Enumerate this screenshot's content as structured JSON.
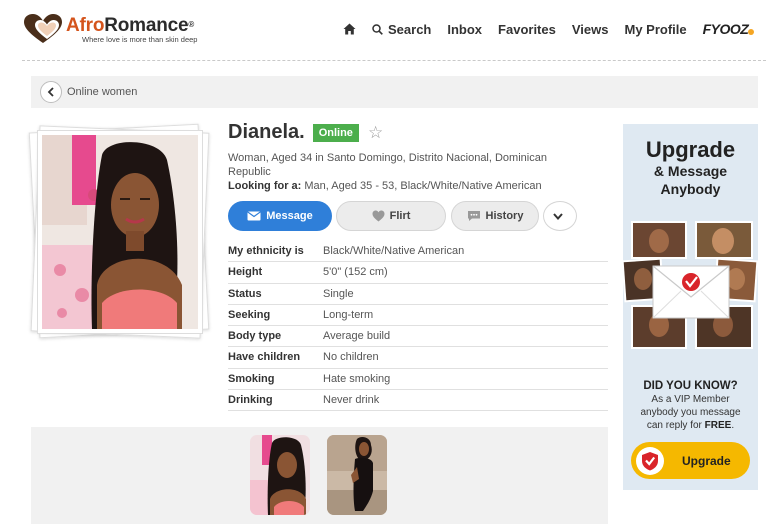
{
  "header": {
    "logo_part1": "Afro",
    "logo_part2": "Romance",
    "logo_reg": "®",
    "tagline": "Where love is more than skin deep",
    "nav": {
      "search": "Search",
      "inbox": "Inbox",
      "favorites": "Favorites",
      "views": "Views",
      "my_profile": "My Profile",
      "fyooz": "FYOOZ"
    }
  },
  "breadcrumb": {
    "label": "Online women"
  },
  "profile": {
    "name": "Dianela.",
    "status_badge": "Online",
    "description": "Woman, Aged 34 in Santo Domingo, Distrito Nacional, Dominican Republic",
    "looking_for_label": "Looking for a:",
    "looking_for_value": "Man, Aged 35 - 53, Black/White/Native American",
    "actions": {
      "message": "Message",
      "flirt": "Flirt",
      "history": "History"
    },
    "details": [
      {
        "label": "My ethnicity is",
        "value": "Black/White/Native American"
      },
      {
        "label": "Height",
        "value": "5'0\" (152 cm)"
      },
      {
        "label": "Status",
        "value": "Single"
      },
      {
        "label": "Seeking",
        "value": "Long-term"
      },
      {
        "label": "Body type",
        "value": "Average build"
      },
      {
        "label": "Have children",
        "value": "No children"
      },
      {
        "label": "Smoking",
        "value": "Hate smoking"
      },
      {
        "label": "Drinking",
        "value": "Never drink"
      }
    ]
  },
  "upgrade": {
    "title": "Upgrade",
    "subtitle_line1": "& Message",
    "subtitle_line2": "Anybody",
    "did_you_know": "DID YOU KNOW?",
    "note_line1": "As a VIP Member",
    "note_line2": "anybody you message",
    "note_line3": "can reply for",
    "note_free": "FREE",
    "note_end": ".",
    "button": "Upgrade"
  },
  "colors": {
    "brand_orange": "#d4541c",
    "online_green": "#4cae4c",
    "message_blue": "#2f7fd9",
    "upgrade_yellow": "#f5b800",
    "upgrade_panel": "#dfe9f2"
  }
}
